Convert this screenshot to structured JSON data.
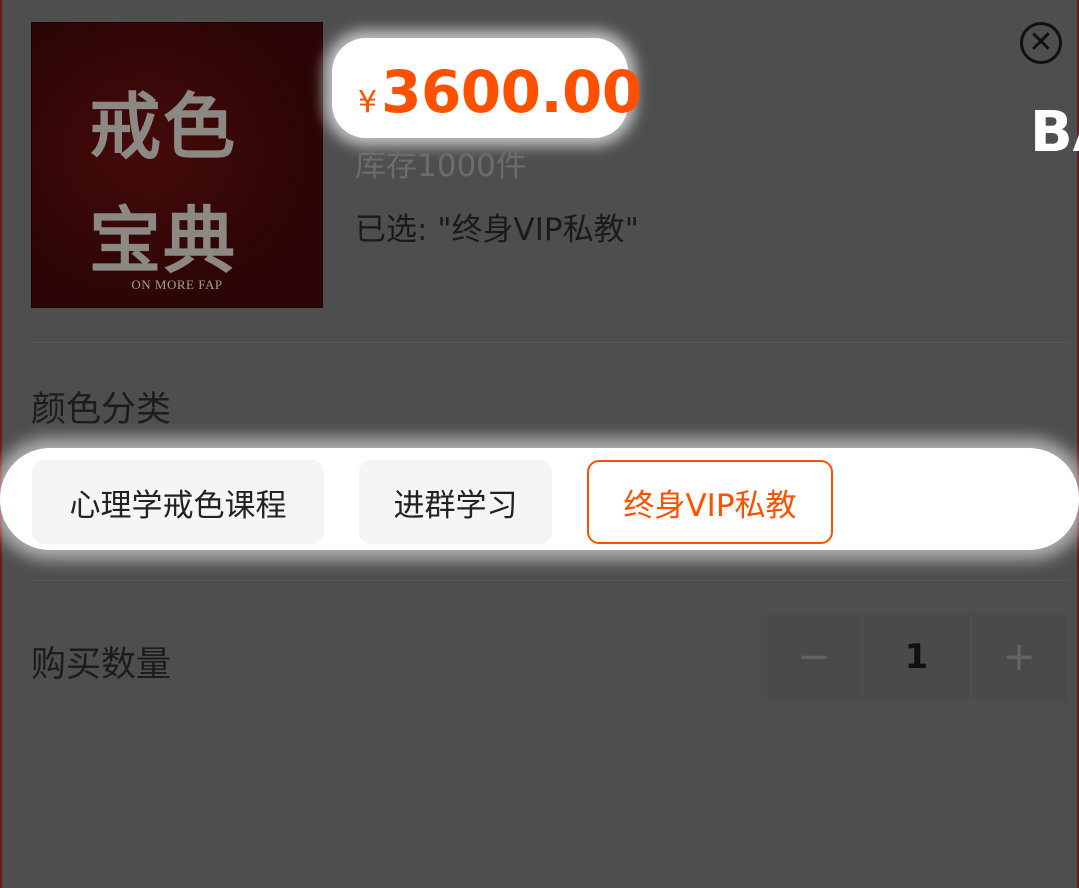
{
  "product": {
    "cover_title": "戒色宝典",
    "cover_subtitle": "ON MORE FAP",
    "currency": "¥",
    "price": "3600.00",
    "stock": "库存1000件",
    "selected": "已选: \"终身VIP私教\""
  },
  "overlay_text": "BA",
  "close_icon": "close-icon",
  "spec": {
    "title": "颜色分类",
    "options": [
      {
        "label": "心理学戒色课程",
        "selected": false
      },
      {
        "label": "进群学习",
        "selected": false
      },
      {
        "label": "终身VIP私教",
        "selected": true
      }
    ]
  },
  "quantity": {
    "title": "购买数量",
    "value": "1",
    "minus": "−",
    "plus": "+"
  },
  "colors": {
    "accent": "#ff5000",
    "backdrop": "#4e4e4e"
  }
}
